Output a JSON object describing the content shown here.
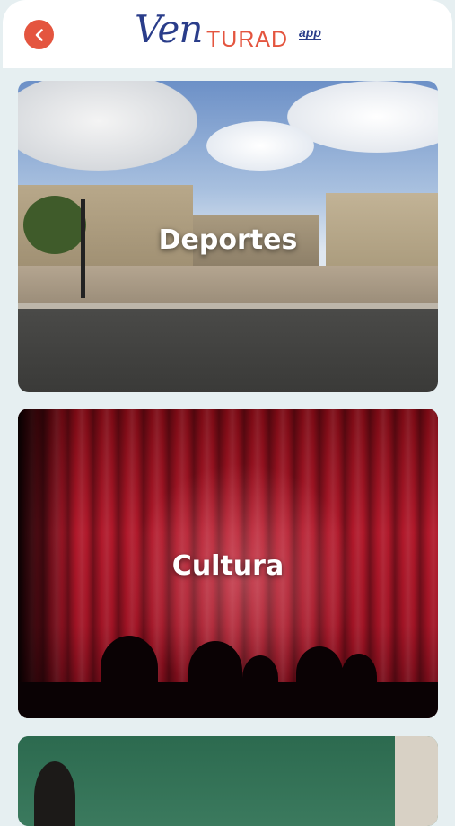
{
  "header": {
    "back_icon": "chevron-left-icon",
    "logo": {
      "ven": "Ven",
      "turad": "TURAD",
      "app": "app"
    }
  },
  "colors": {
    "accent": "#e4553f",
    "brand_blue": "#2a3d8a",
    "background": "#e6eff1"
  },
  "categories": [
    {
      "label": "Deportes",
      "image": "sports-facility-photo"
    },
    {
      "label": "Cultura",
      "image": "theater-curtain-photo"
    },
    {
      "label": "",
      "image": "classroom-chalkboard-photo"
    }
  ]
}
